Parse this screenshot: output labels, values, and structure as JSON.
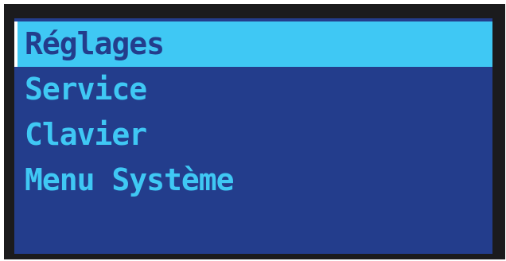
{
  "menu": {
    "items": [
      {
        "label": "Réglages",
        "selected": true
      },
      {
        "label": "Service",
        "selected": false
      },
      {
        "label": "Clavier",
        "selected": false
      },
      {
        "label": "Menu Système",
        "selected": false
      }
    ]
  },
  "colors": {
    "background": "#233d8c",
    "text": "#3fc8f4",
    "highlight": "#3fc8f4",
    "bezel": "#1b1b1d"
  }
}
